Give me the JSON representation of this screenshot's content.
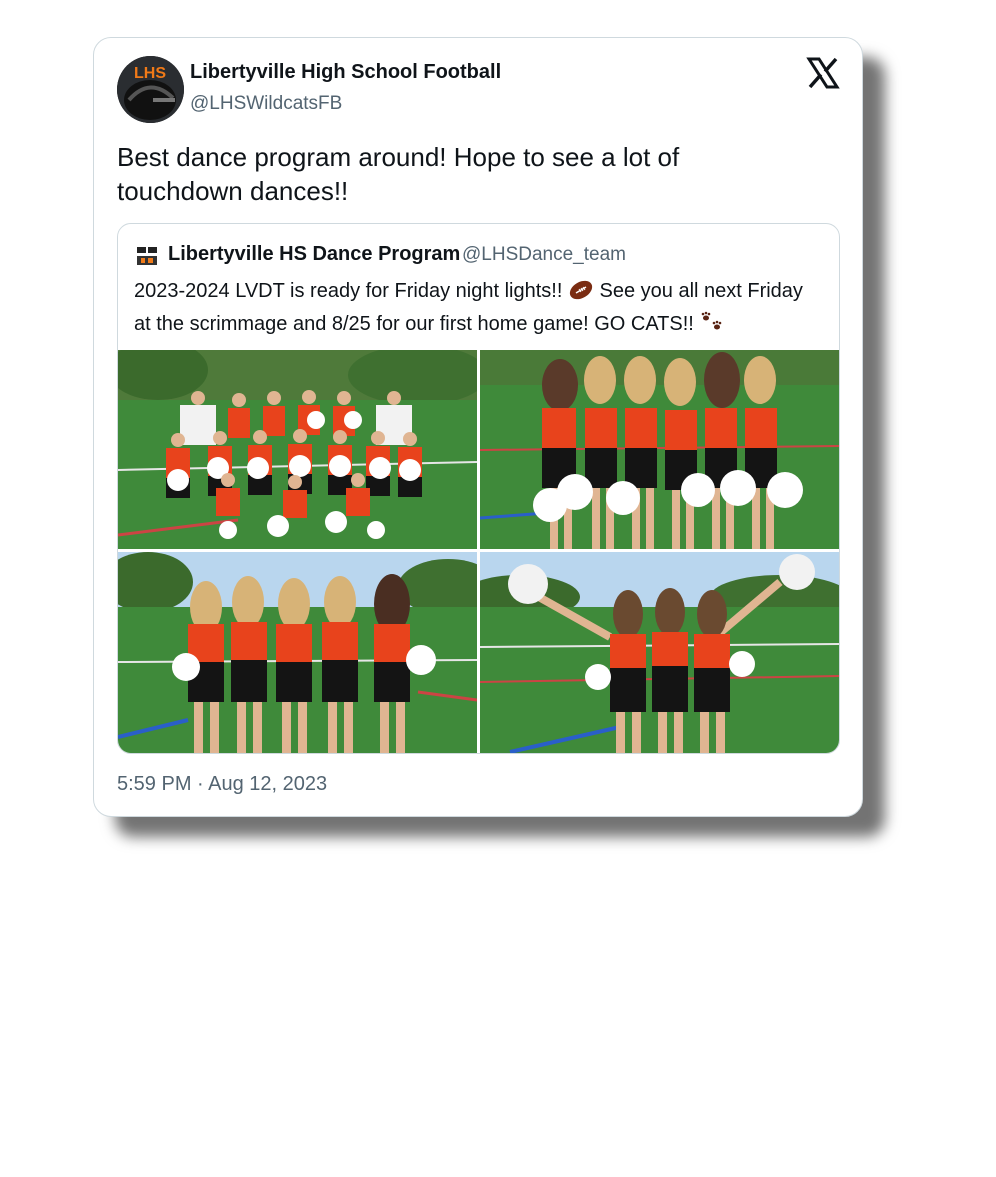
{
  "tweet": {
    "author_name": "Libertyville High School Football",
    "author_handle": "@LHSWildcatsFB",
    "avatar_text": "LHS",
    "text": "Best dance program around! Hope to see a lot of touchdown dances!!",
    "timestamp": "5:59 PM · Aug 12, 2023",
    "platform_icon": "x-logo-icon"
  },
  "quoted_tweet": {
    "author_name": "Libertyville HS Dance Program",
    "author_handle": "@LHSDance_team",
    "text_part1": "2023-2024 LVDT is ready for Friday night lights!! ",
    "emoji1": "football-emoji",
    "text_part2": " See you all next Friday at the scrimmage and 8/25 for our first home game! GO CATS!! ",
    "emoji2": "paw-prints-emoji",
    "photos": [
      "team-group-photo",
      "six-dancers-photo",
      "five-dancers-photo",
      "three-dancers-photo"
    ]
  },
  "colors": {
    "text_primary": "#0f1419",
    "text_secondary": "#536471",
    "border": "#cfd9de",
    "uniform_orange": "#e8431c",
    "field_green": "#3f8a3a"
  }
}
